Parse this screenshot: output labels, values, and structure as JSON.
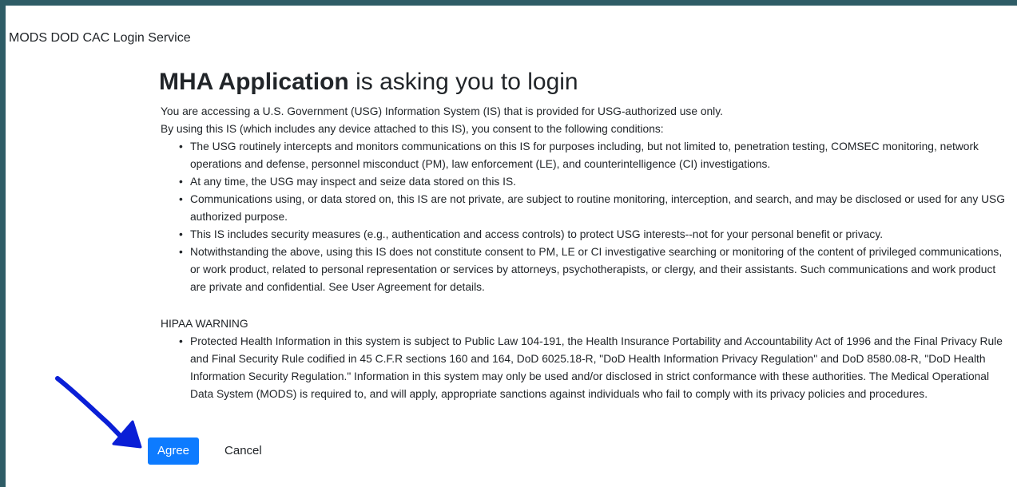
{
  "service": {
    "title": "MODS DOD CAC Login Service"
  },
  "heading": {
    "app_name": "MHA Application",
    "suffix": " is asking you to login"
  },
  "intro": [
    "You are accessing a U.S. Government (USG) Information System (IS) that is provided for USG-authorized use only.",
    "By using this IS (which includes any device attached to this IS), you consent to the following conditions:"
  ],
  "conditions": [
    "The USG routinely intercepts and monitors communications on this IS for purposes including, but not limited to, penetration testing, COMSEC monitoring, network operations and defense, personnel misconduct (PM), law enforcement (LE), and counterintelligence (CI) investigations.",
    "At any time, the USG may inspect and seize data stored on this IS.",
    "Communications using, or data stored on, this IS are not private, are subject to routine monitoring, interception, and search, and may be disclosed or used for any USG authorized purpose.",
    "This IS includes security measures (e.g., authentication and access controls) to protect USG interests--not for your personal benefit or privacy.",
    "Notwithstanding the above, using this IS does not constitute consent to PM, LE or CI investigative searching or monitoring of the content of privileged communications, or work product, related to personal representation or services by attorneys, psychotherapists, or clergy, and their assistants. Such communications and work product are private and confidential. See User Agreement for details."
  ],
  "hipaa": {
    "title": "HIPAA WARNING",
    "items": [
      "Protected Health Information in this system is subject to Public Law 104-191, the Health Insurance Portability and Accountability Act of 1996 and the Final Privacy Rule and Final Security Rule codified in 45 C.F.R sections 160 and 164, DoD 6025.18-R, \"DoD Health Information Privacy Regulation\" and DoD 8580.08-R, \"DoD Health Information Security Regulation.\" Information in this system may only be used and/or disclosed in strict conformance with these authorities. The Medical Operational Data System (MODS) is required to, and will apply, appropriate sanctions against individuals who fail to comply with its privacy policies and procedures."
    ]
  },
  "buttons": {
    "agree_label": "Agree",
    "cancel_label": "Cancel"
  },
  "colors": {
    "background": "#2e5c66",
    "primary": "#0d7bff",
    "annotation_arrow": "#0a1fd6"
  },
  "annotation": {
    "icon": "arrow-pointer-icon"
  }
}
